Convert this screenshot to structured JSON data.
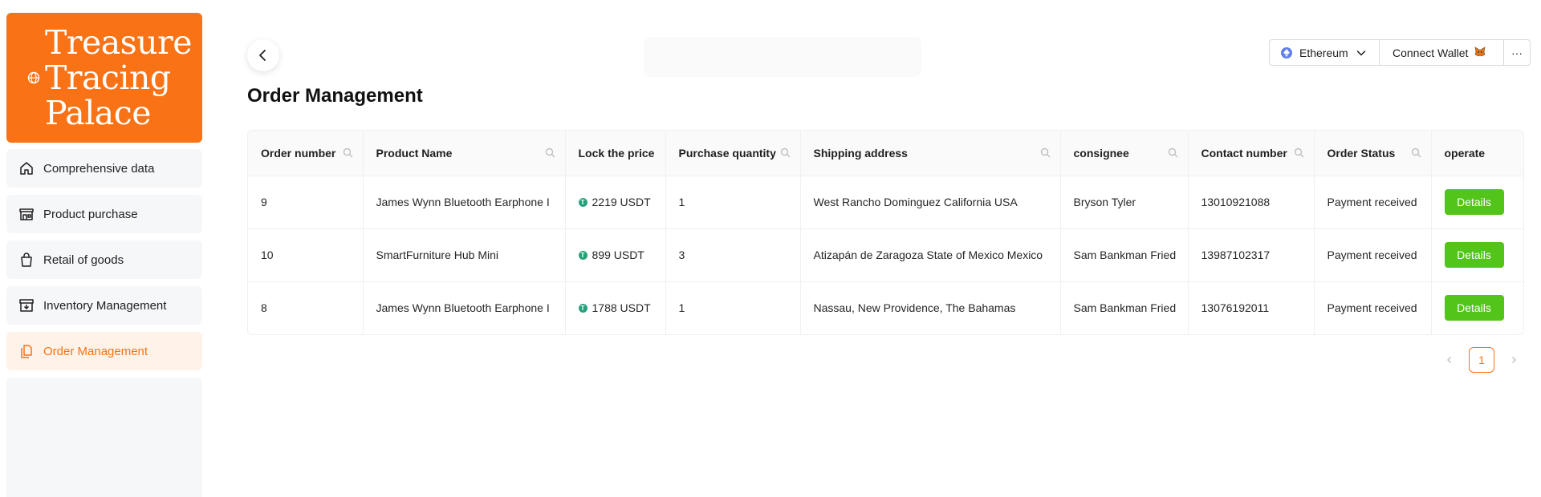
{
  "brand": {
    "lines": [
      "Treasure",
      "Tracing",
      "Palace"
    ],
    "icon": "globe-icon",
    "color": "#f97316"
  },
  "sidebar": {
    "items": [
      {
        "label": "Comprehensive data",
        "icon": "home-icon"
      },
      {
        "label": "Product purchase",
        "icon": "store-icon"
      },
      {
        "label": "Retail of goods",
        "icon": "shopping-bag-icon"
      },
      {
        "label": "Inventory Management",
        "icon": "inventory-box-icon"
      },
      {
        "label": "Order Management",
        "icon": "copy-docs-icon",
        "active": true
      }
    ]
  },
  "header": {
    "back_icon": "chevron-left-icon",
    "chain": {
      "label": "Ethereum",
      "icon": "ethereum-icon"
    },
    "connect_label": "Connect Wallet",
    "connect_icon": "metamask-fox-icon",
    "more_label": "···"
  },
  "page": {
    "title": "Order Management"
  },
  "table": {
    "columns": [
      {
        "label": "Order number",
        "searchable": true
      },
      {
        "label": "Product Name",
        "searchable": true
      },
      {
        "label": "Lock the price",
        "searchable": false
      },
      {
        "label": "Purchase quantity",
        "searchable": true
      },
      {
        "label": "Shipping address",
        "searchable": true
      },
      {
        "label": "consignee",
        "searchable": true
      },
      {
        "label": "Contact number",
        "searchable": true
      },
      {
        "label": "Order Status",
        "searchable": true
      },
      {
        "label": "operate",
        "searchable": false
      }
    ],
    "rows": [
      {
        "order": "9",
        "product": "James Wynn Bluetooth Earphone I",
        "price": "2219 USDT",
        "qty": "1",
        "address": "West Rancho Dominguez California USA",
        "consignee": "Bryson Tyler",
        "phone": "13010921088",
        "status": "Payment received",
        "action": "Details"
      },
      {
        "order": "10",
        "product": "SmartFurniture Hub Mini",
        "price": "899 USDT",
        "qty": "3",
        "address": "Atizapán de Zaragoza State of Mexico Mexico",
        "consignee": "Sam Bankman Fried",
        "phone": "13987102317",
        "status": "Payment received",
        "action": "Details"
      },
      {
        "order": "8",
        "product": "James Wynn Bluetooth Earphone I",
        "price": "1788 USDT",
        "qty": "1",
        "address": "Nassau, New Providence, The Bahamas",
        "consignee": "Sam Bankman Fried",
        "phone": "13076192011",
        "status": "Payment received",
        "action": "Details"
      }
    ]
  },
  "pagination": {
    "current": "1"
  },
  "colors": {
    "accent": "#f97316",
    "success": "#52c41a",
    "usdt": "#26a17b",
    "ethereum": "#627eea"
  }
}
